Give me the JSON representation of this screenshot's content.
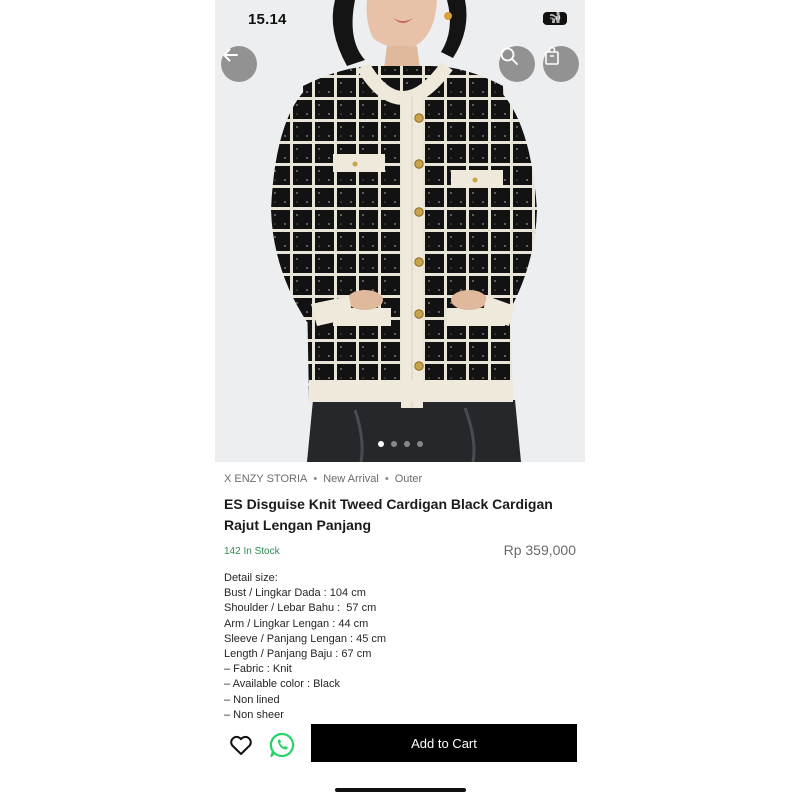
{
  "status_bar": {
    "time": "15.14",
    "battery": "80"
  },
  "product": {
    "breadcrumb": [
      "X ENZY STORIA",
      "New Arrival",
      "Outer"
    ],
    "title": "ES Disguise Knit Tweed Cardigan Black Cardigan Rajut Lengan Panjang",
    "stock": "142 In Stock",
    "price": "Rp 359,000",
    "details": [
      "Detail size:",
      "Bust / Lingkar Dada : 104 cm",
      "Shoulder / Lebar Bahu :  57 cm",
      "Arm / Lingkar Lengan : 44 cm",
      "Sleeve / Panjang Lengan : 45 cm",
      "Length / Panjang Baju : 67 cm",
      "– Fabric : Knit",
      "– Available color : Black",
      "– Non lined",
      "– Non sheer"
    ]
  },
  "actions": {
    "add_to_cart": "Add to Cart"
  },
  "icons": {
    "back": "arrow-left-icon",
    "search": "search-icon",
    "bag": "shopping-bag-icon",
    "wishlist": "heart-icon",
    "chat": "whatsapp-icon"
  },
  "carousel": {
    "active_index": 0,
    "count": 4
  },
  "colors": {
    "accent": "#000000",
    "stock": "#2e8b57",
    "whatsapp": "#25d366"
  }
}
